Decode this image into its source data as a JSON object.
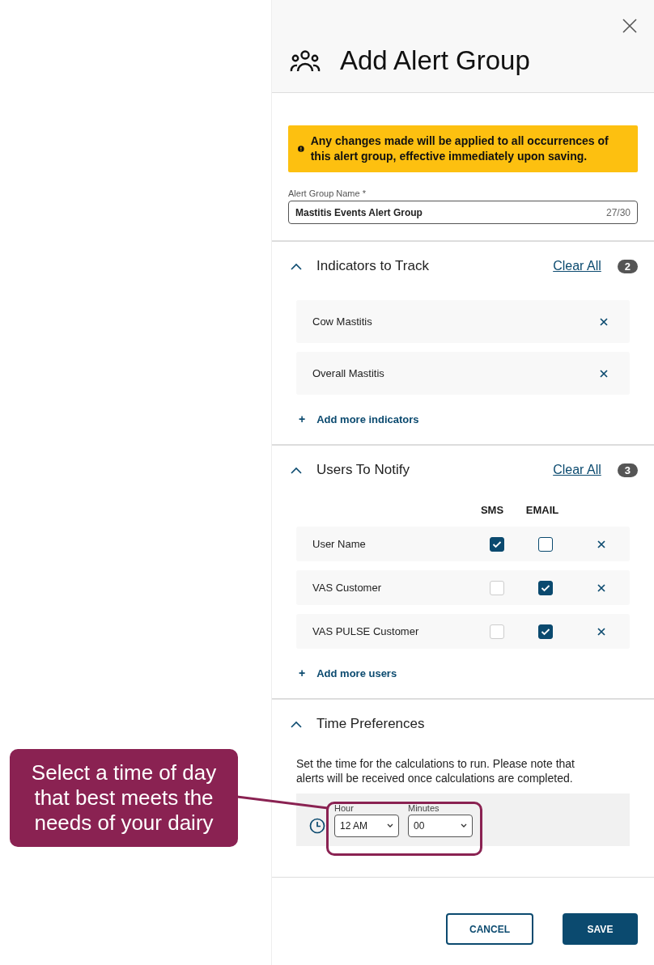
{
  "panel": {
    "title": "Add Alert Group"
  },
  "warning": "Any changes made will be applied to all occurrences of this alert group, effective immediately upon saving.",
  "name_field": {
    "label": "Alert Group Name *",
    "value": "Mastitis Events Alert Group",
    "counter": "27/30"
  },
  "indicators": {
    "title": "Indicators to Track",
    "expanded": true,
    "clear": "Clear All",
    "count": "2",
    "items": [
      {
        "name": "Cow Mastitis"
      },
      {
        "name": "Overall Mastitis"
      }
    ],
    "add_icon": "+",
    "add": "Add more indicators"
  },
  "users": {
    "title": "Users To Notify",
    "expanded": true,
    "clear": "Clear All",
    "count": "3",
    "columns": [
      "SMS",
      "EMAIL"
    ],
    "rows": [
      {
        "name": "User Name",
        "sms": true,
        "email": false
      },
      {
        "name": "VAS Customer",
        "sms": false,
        "email": true
      },
      {
        "name": "VAS PULSE Customer",
        "sms": false,
        "email": true
      }
    ],
    "add_icon": "+",
    "add": "Add more users"
  },
  "time": {
    "title": "Time Preferences",
    "expanded": true,
    "note": "Set the time for the calculations to run. Please note that alerts will be received once calculations are completed.",
    "hour": {
      "label": "Hour",
      "value": "12 AM"
    },
    "minutes": {
      "label": "Minutes",
      "value": "00"
    }
  },
  "buttons": {
    "cancel": "CANCEL",
    "save": "SAVE"
  },
  "callout": {
    "text": "Select a time of day that best meets the needs of your dairy"
  }
}
